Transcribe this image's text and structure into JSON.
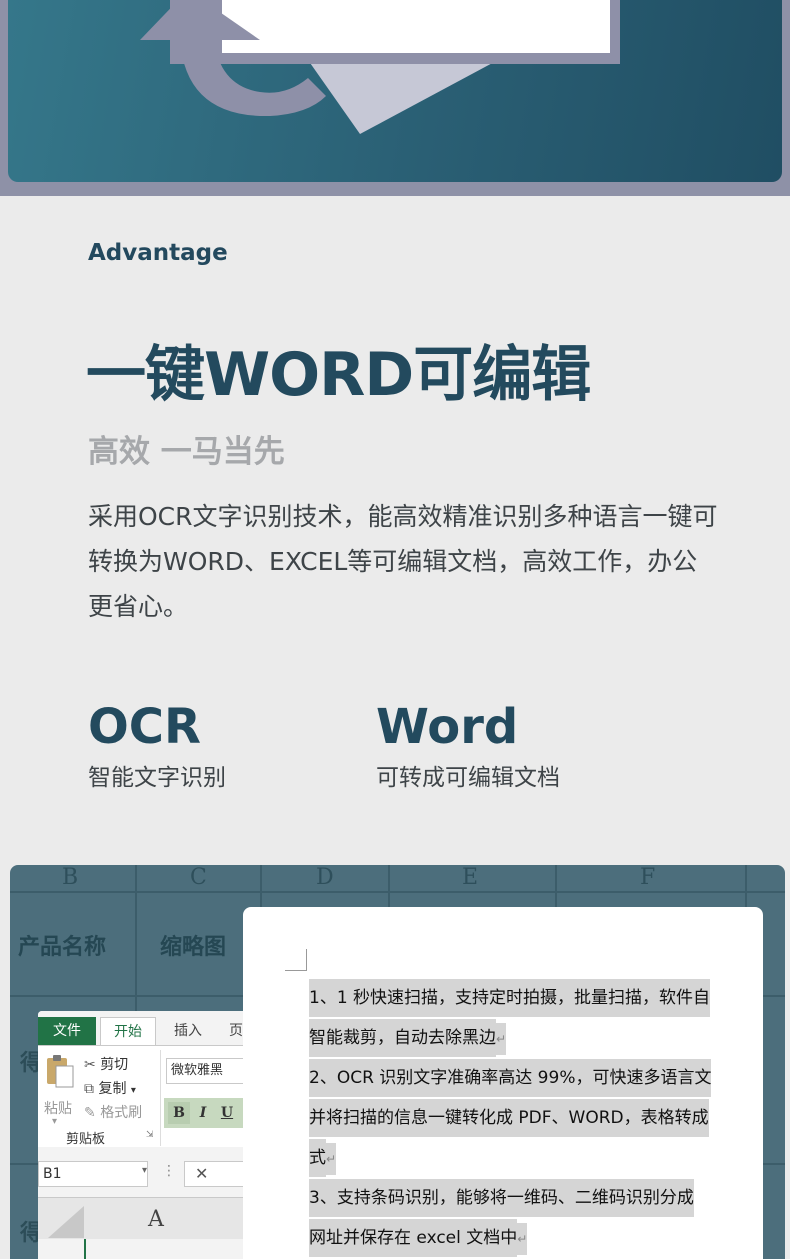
{
  "advantage": {
    "label": "Advantage",
    "headline": "一键WORD可编辑",
    "subhead": "高效  一马当先",
    "description": "采用OCR文字识别技术，能高效精准识别多种语言一键可转换为WORD、EXCEL等可编辑文档，高效工作，办公更省心。"
  },
  "features": [
    {
      "title": "OCR",
      "subtitle": "智能文字识别"
    },
    {
      "title": "Word",
      "subtitle": "可转成可编辑文档"
    }
  ],
  "spreadsheet": {
    "columns": [
      "B",
      "C",
      "D",
      "E",
      "F"
    ],
    "headers": [
      "产品名称",
      "缩略图"
    ],
    "row_char": "得"
  },
  "excel": {
    "tab_file": "文件",
    "tab_home": "开始",
    "tab_insert": "插入",
    "tab_partial": "页",
    "cut": "剪切",
    "copy": "复制",
    "format_painter": "格式刷",
    "paste": "粘贴",
    "clipboard": "剪贴板",
    "font": "微软雅黑",
    "bold": "B",
    "italic": "I",
    "underline": "U",
    "name_box": "B1",
    "cancel_glyph": "✕",
    "column_a": "A"
  },
  "document": {
    "lines": [
      "1、1 秒快速扫描，支持定时拍摄，批量扫描，软件自",
      "智能裁剪，自动去除黑边",
      "2、OCR 识别文字准确率高达 99%，可快速多语言文",
      "并将扫描的信息一键转化成 PDF、WORD，表格转成",
      "式",
      "3、支持条码识别，能够将一维码、二维码识别分成",
      "网址并保存在 excel 文档中"
    ]
  },
  "colors": {
    "primary": "#234a5e",
    "subhead": "#a6a8ab",
    "banner": "#2a5f74",
    "excel_green": "#217346"
  }
}
